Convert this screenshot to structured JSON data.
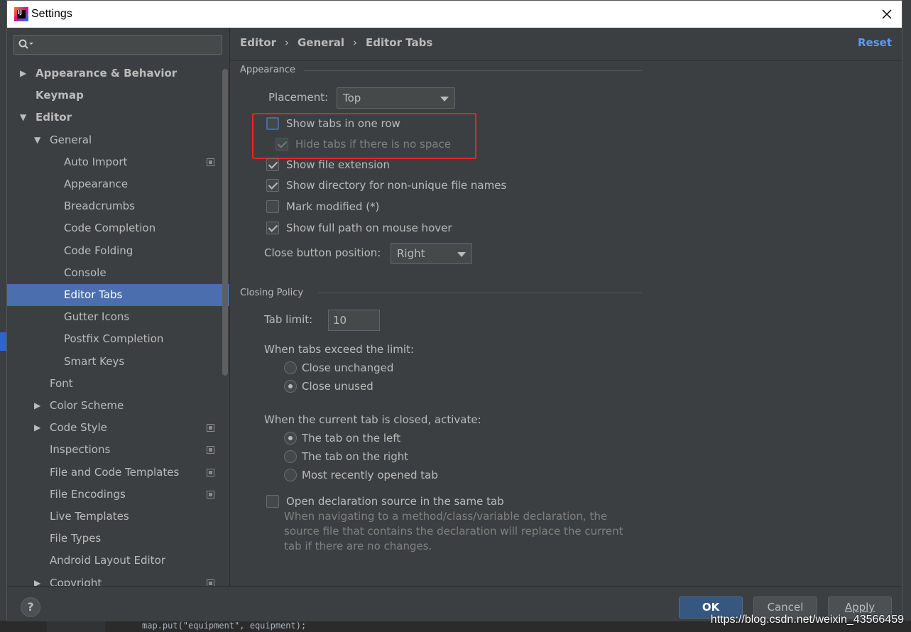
{
  "window": {
    "title": "Settings"
  },
  "sidebar": {
    "search": {
      "value": ""
    },
    "items": [
      {
        "label": "Appearance & Behavior",
        "arrow": "▶",
        "bold": true
      },
      {
        "label": "Keymap",
        "arrow": "",
        "bold": true
      },
      {
        "label": "Editor",
        "arrow": "▼",
        "bold": true
      },
      {
        "label": "General",
        "arrow": "▼"
      },
      {
        "label": "Auto Import",
        "project_icon": true
      },
      {
        "label": "Appearance"
      },
      {
        "label": "Breadcrumbs"
      },
      {
        "label": "Code Completion"
      },
      {
        "label": "Code Folding"
      },
      {
        "label": "Console"
      },
      {
        "label": "Editor Tabs",
        "selected": true
      },
      {
        "label": "Gutter Icons"
      },
      {
        "label": "Postfix Completion"
      },
      {
        "label": "Smart Keys"
      },
      {
        "label": "Font"
      },
      {
        "label": "Color Scheme",
        "arrow": "▶"
      },
      {
        "label": "Code Style",
        "arrow": "▶",
        "project_icon": true
      },
      {
        "label": "Inspections",
        "project_icon": true
      },
      {
        "label": "File and Code Templates",
        "project_icon": true
      },
      {
        "label": "File Encodings",
        "project_icon": true
      },
      {
        "label": "Live Templates"
      },
      {
        "label": "File Types"
      },
      {
        "label": "Android Layout Editor"
      },
      {
        "label": "Copyright",
        "arrow": "▶",
        "project_icon": true
      }
    ]
  },
  "breadcrumb": {
    "items": [
      "Editor",
      "General",
      "Editor Tabs"
    ],
    "separator": "›"
  },
  "reset_label": "Reset",
  "appearance": {
    "title": "Appearance",
    "placement_label": "Placement:",
    "placement_value": "Top",
    "show_tabs_one_row": {
      "label": "Show tabs in one row",
      "checked": false
    },
    "hide_tabs_no_space": {
      "label": "Hide tabs if there is no space",
      "checked": true,
      "disabled": true
    },
    "show_file_extension": {
      "label": "Show file extension",
      "checked": true
    },
    "show_directory": {
      "label": "Show directory for non-unique file names",
      "checked": true
    },
    "mark_modified": {
      "label": "Mark modified (*)",
      "checked": false
    },
    "show_full_path": {
      "label": "Show full path on mouse hover",
      "checked": true
    },
    "close_button_label": "Close button position:",
    "close_button_value": "Right"
  },
  "closing_policy": {
    "title": "Closing Policy",
    "tab_limit_label": "Tab limit:",
    "tab_limit_value": "10",
    "exceed_label": "When tabs exceed the limit:",
    "close_unchanged": {
      "label": "Close unchanged",
      "selected": false
    },
    "close_unused": {
      "label": "Close unused",
      "selected": true
    },
    "activate_label": "When the current tab is closed, activate:",
    "tab_left": {
      "label": "The tab on the left",
      "selected": true
    },
    "tab_right": {
      "label": "The tab on the right",
      "selected": false
    },
    "most_recent": {
      "label": "Most recently opened tab",
      "selected": false
    },
    "open_declaration": {
      "label": "Open declaration source in the same tab",
      "checked": false
    },
    "open_declaration_hint": "When navigating to a method/class/variable declaration, the source file that contains the declaration will replace the current tab if there are no changes."
  },
  "footer": {
    "help_label": "?",
    "ok_label": "OK",
    "cancel_label": "Cancel",
    "apply_label": "Apply"
  },
  "background": {
    "code_snippet": "map.put(\"equipment\", equipment);",
    "watermark": "https://blog.csdn.net/weixin_43566459"
  },
  "colors": {
    "selection": "#4b6eaf",
    "link": "#589df6",
    "ok_button": "#365880",
    "highlight_box": "#ff2020"
  }
}
